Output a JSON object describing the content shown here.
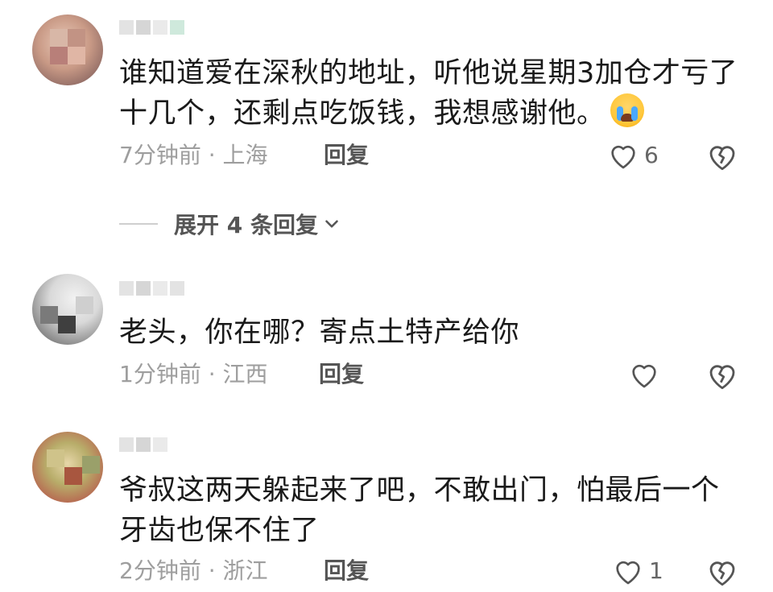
{
  "comments": [
    {
      "text": "谁知道爱在深秋的地址，听他说星期3加仓才亏了十几个，还剩点吃饭钱，我想感谢他。",
      "emoji": "loudly-crying-face-emoji",
      "meta": "7分钟前 · 上海",
      "reply_label": "回复",
      "likes": "6",
      "expand_label": "展开 4 条回复"
    },
    {
      "text": "老头，你在哪？寄点土特产给你",
      "meta": "1分钟前 · 江西",
      "reply_label": "回复",
      "likes": ""
    },
    {
      "text": "爷叔这两天躲起来了吧，不敢出门，怕最后一个牙齿也保不住了",
      "meta": "2分钟前 · 浙江",
      "reply_label": "回复",
      "likes": "1"
    }
  ],
  "icons": {
    "like": "heart-outline-icon",
    "dislike": "broken-heart-icon",
    "expand": "chevron-down-icon"
  }
}
